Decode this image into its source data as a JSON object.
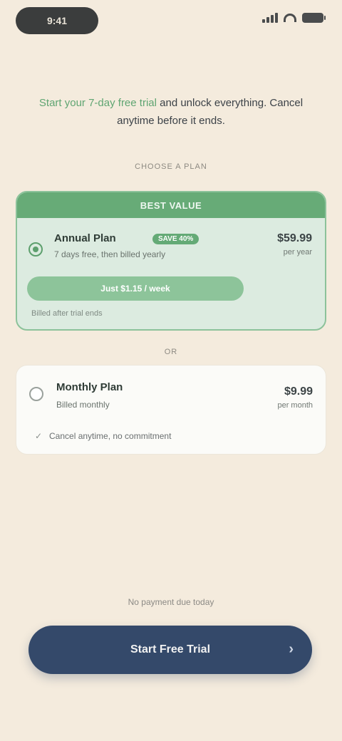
{
  "status": {
    "time": "9:41"
  },
  "intro": {
    "highlight": "Start your 7-day free trial",
    "rest": "and unlock everything. Cancel anytime before it ends."
  },
  "sections": {
    "choose_label": "Choose a plan",
    "or_label": "or"
  },
  "selected_plan": {
    "banner": "BEST VALUE",
    "name": "Annual Plan",
    "badge": "SAVE 40%",
    "subtitle": "7 days free, then billed yearly",
    "price": "$59.99",
    "price_sub": "per year",
    "pill": "Just $1.15 / week",
    "note": "Billed after trial ends"
  },
  "other_plan": {
    "name": "Monthly Plan",
    "subtitle": "Billed monthly",
    "price": "$9.99",
    "price_sub": "per month",
    "feature": "Cancel anytime, no commitment"
  },
  "footer": {
    "note": "No payment due today",
    "cta": "Start Free Trial",
    "cta_icon": "arrow-right-icon"
  },
  "colors": {
    "background": "#f4ebdd",
    "accent_green": "#67ab77",
    "cta_blue": "#34496a"
  }
}
